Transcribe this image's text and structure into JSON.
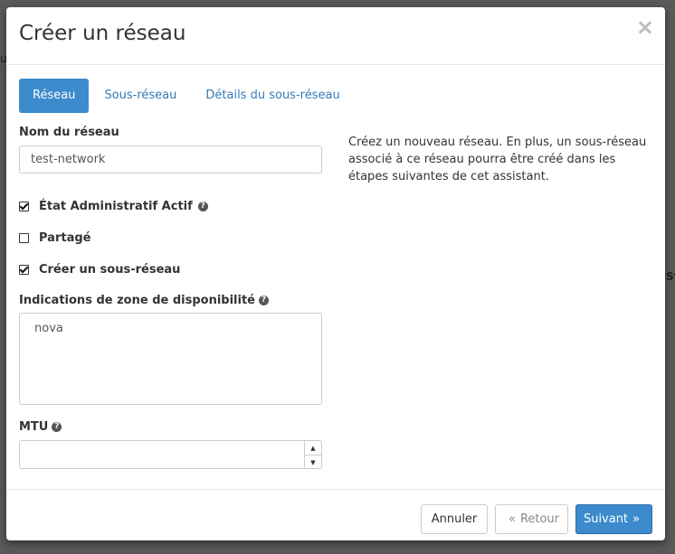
{
  "modal": {
    "title": "Créer un réseau",
    "close_label": "×"
  },
  "tabs": [
    {
      "label": "Réseau",
      "active": true
    },
    {
      "label": "Sous-réseau",
      "active": false
    },
    {
      "label": "Détails du sous-réseau",
      "active": false
    }
  ],
  "form": {
    "network_name": {
      "label": "Nom du réseau",
      "value": "test-network"
    },
    "admin_state": {
      "label": "État Administratif Actif",
      "checked": true,
      "help_icon": "question-circle-icon"
    },
    "shared": {
      "label": "Partagé",
      "checked": false
    },
    "create_subnet": {
      "label": "Créer un sous-réseau",
      "checked": true
    },
    "az_hints": {
      "label": "Indications de zone de disponibilité",
      "options": [
        "nova"
      ],
      "help_icon": "question-circle-icon"
    },
    "mtu": {
      "label": "MTU",
      "value": "",
      "help_icon": "question-circle-icon"
    }
  },
  "description": "Créez un nouveau réseau. En plus, un sous-réseau associé à ce réseau pourra être créé dans les étapes suivantes de cet assistant.",
  "footer": {
    "cancel": "Annuler",
    "back": "Retour",
    "back_glyph": "«",
    "next": "Suivant",
    "next_glyph": "»"
  },
  "backdrop": {
    "left_sliver": "u",
    "right_sliver": "St"
  },
  "colors": {
    "primary": "#3d8bcd",
    "link": "#337ab7"
  }
}
